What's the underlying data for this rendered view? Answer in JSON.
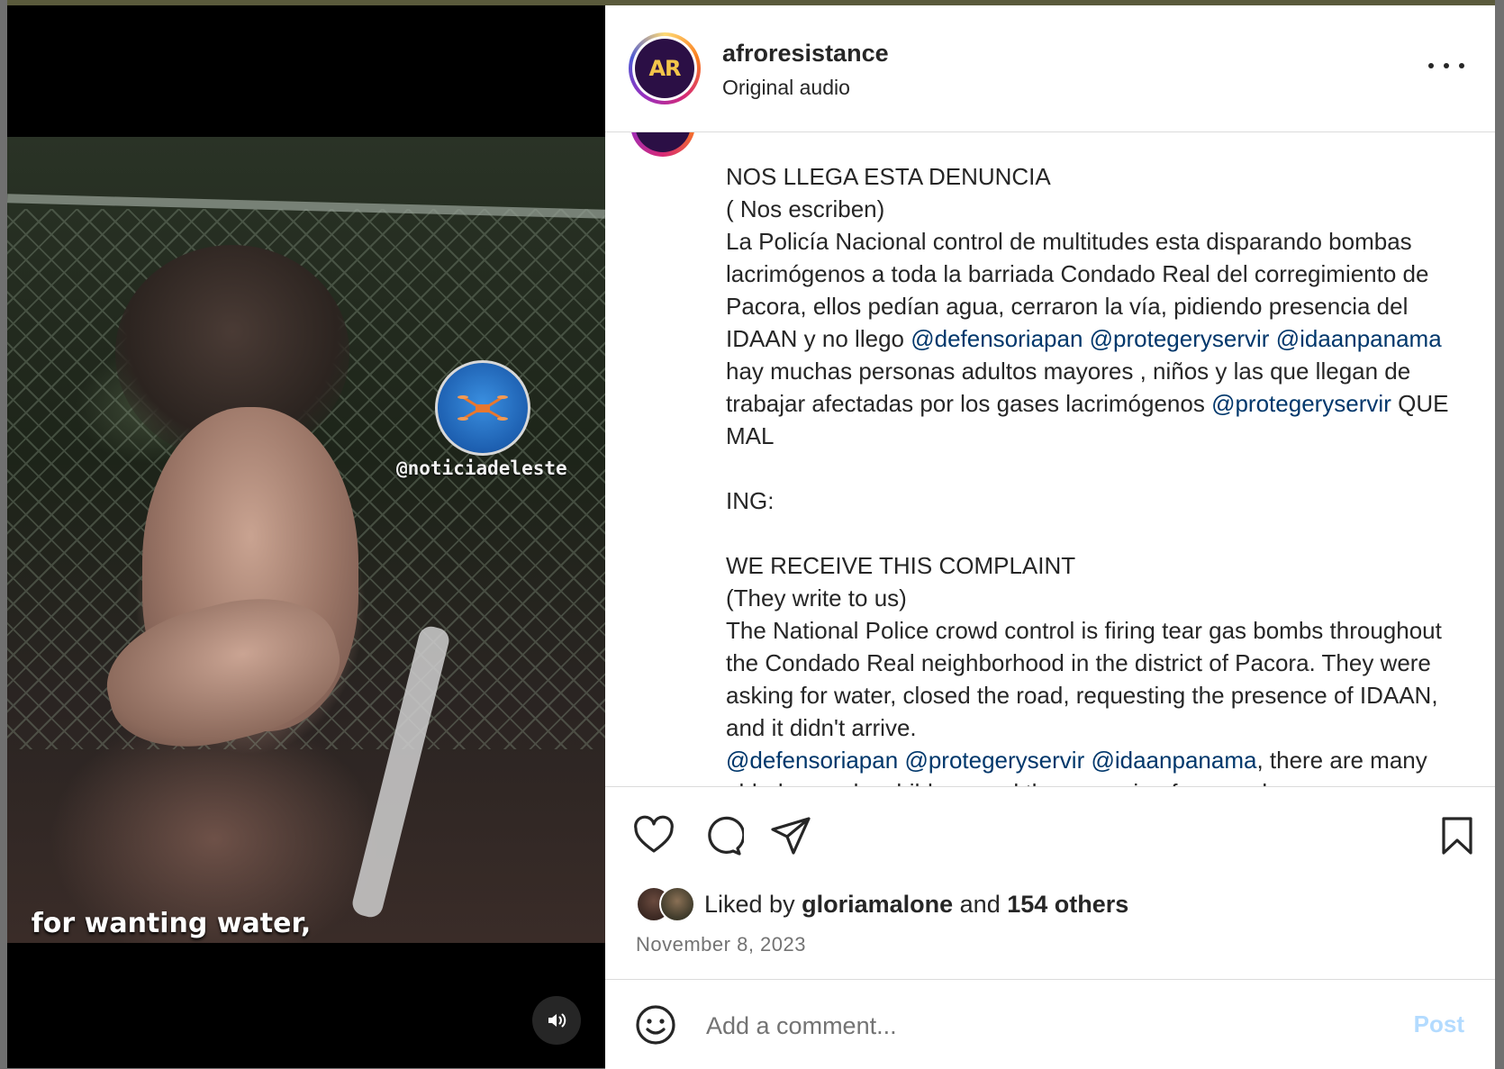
{
  "video": {
    "watermark_handle": "@noticiadeleste",
    "subtitle": "for wanting water,"
  },
  "header": {
    "username": "afroresistance",
    "audio_label": "Original audio",
    "avatar_text": "AR"
  },
  "caption": {
    "segments": [
      {
        "text": "NOS LLEGA ESTA DENUNCIA\n( Nos escriben)\nLa Policía Nacional control de multitudes esta disparando bombas lacrimógenos a toda la barriada Condado Real del corregimiento de Pacora, ellos pedían agua, cerraron la vía, pidiendo presencia del IDAAN y no llego "
      },
      {
        "text": "@defensoriapan",
        "mention": true
      },
      {
        "text": " "
      },
      {
        "text": "@protegeryservir",
        "mention": true
      },
      {
        "text": " "
      },
      {
        "text": "@idaanpanama",
        "mention": true
      },
      {
        "text": " hay muchas personas adultos mayores , niños y las que llegan de trabajar afectadas por los gases lacrimógenos "
      },
      {
        "text": "@protegeryservir",
        "mention": true
      },
      {
        "text": " QUE MAL\n\nING:\n\nWE RECEIVE THIS COMPLAINT\n(They write to us)\nThe National Police crowd control is firing tear gas bombs throughout the Condado Real neighborhood in the district of Pacora. They were asking for water, closed the road, requesting the presence of IDAAN, and it didn't arrive.\n"
      },
      {
        "text": "@defensoriapan",
        "mention": true
      },
      {
        "text": " "
      },
      {
        "text": "@protegeryservir",
        "mention": true
      },
      {
        "text": " "
      },
      {
        "text": "@idaanpanama",
        "mention": true
      },
      {
        "text": ", there are many elderly people, children, and those coming from work"
      }
    ]
  },
  "likes": {
    "prefix": "Liked by",
    "user": "gloriamalone",
    "and": "and",
    "others": "154 others"
  },
  "date": "November 8, 2023",
  "comment": {
    "placeholder": "Add a comment...",
    "post_label": "Post"
  },
  "icons": {
    "like": "heart-icon",
    "comment": "comment-icon",
    "share": "share-icon",
    "save": "bookmark-icon",
    "more": "more-icon",
    "emoji": "emoji-icon",
    "mute": "speaker-icon"
  },
  "colors": {
    "mention": "#00376b",
    "post_disabled": "#b3dbff",
    "muted_text": "#737373"
  }
}
